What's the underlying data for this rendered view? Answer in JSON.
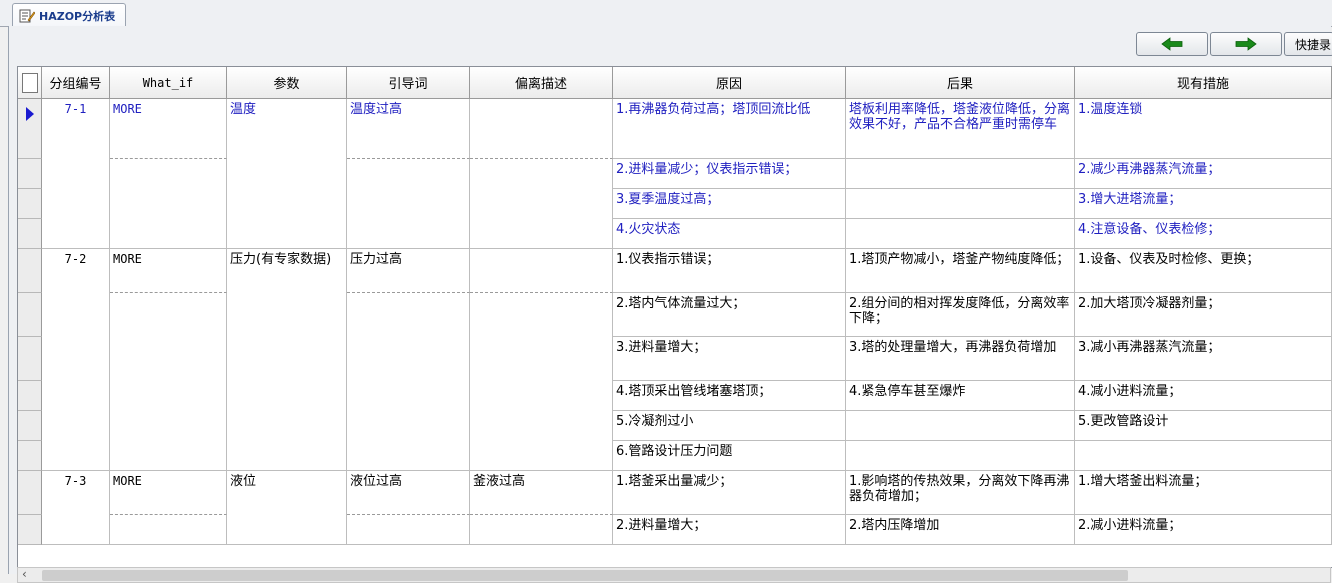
{
  "tab": {
    "title": "HAZOP分析表"
  },
  "toolbar": {
    "prev_icon": "arrow-left-icon",
    "next_icon": "arrow-right-icon",
    "shortcut_label": "快捷录",
    "arrow_color": "#1a8a1a"
  },
  "columns": [
    "分组编号",
    "What_if",
    "参数",
    "引导词",
    "偏离描述",
    "原因",
    "后果",
    "现有措施"
  ],
  "groups": [
    {
      "id": "7-1",
      "what_if": "MORE",
      "param": "温度",
      "guide": "温度过高",
      "deviation": ""
    },
    {
      "id": "7-2",
      "what_if": "MORE",
      "param": "压力(有专家数据)",
      "guide": "压力过高",
      "deviation": ""
    },
    {
      "id": "7-3",
      "what_if": "MORE",
      "param": "液位",
      "guide": "液位过高",
      "deviation": "釜液过高"
    }
  ],
  "rows": [
    {
      "cause": "1.再沸器负荷过高；塔顶回流比低",
      "consequence": "塔板利用率降低，塔釜液位降低，分离效果不好，产品不合格严重时需停车",
      "measure": "1.温度连锁"
    },
    {
      "cause": "2.进料量减少；仪表指示错误；",
      "consequence": "",
      "measure": "2.减少再沸器蒸汽流量；"
    },
    {
      "cause": "3.夏季温度过高；",
      "consequence": "",
      "measure": "3.增大进塔流量；"
    },
    {
      "cause": "4.火灾状态",
      "consequence": "",
      "measure": "4.注意设备、仪表检修；"
    },
    {
      "cause": "1.仪表指示错误；",
      "consequence": "1.塔顶产物减小，塔釜产物纯度降低；",
      "measure": "1.设备、仪表及时检修、更换；"
    },
    {
      "cause": "2.塔内气体流量过大；",
      "consequence": "2.组分间的相对挥发度降低，分离效率下降；",
      "measure": "2.加大塔顶冷凝器剂量；"
    },
    {
      "cause": "3.进料量增大；",
      "consequence": "3.塔的处理量增大，再沸器负荷增加",
      "measure": "3.减小再沸器蒸汽流量；"
    },
    {
      "cause": "4.塔顶采出管线堵塞塔顶；",
      "consequence": "4.紧急停车甚至爆炸",
      "measure": "4.减小进料流量；"
    },
    {
      "cause": "5.冷凝剂过小",
      "consequence": "",
      "measure": "5.更改管路设计"
    },
    {
      "cause": "6.管路设计压力问题",
      "consequence": "",
      "measure": ""
    },
    {
      "cause": "1.塔釜采出量减少；",
      "consequence": "1.影响塔的传热效果，分离效下降再沸器负荷增加；",
      "measure": "1.增大塔釜出料流量；"
    },
    {
      "cause": "2.进料量增大；",
      "consequence": "2.塔内压降增加",
      "measure": "2.减小进料流量；"
    }
  ],
  "scrollbar": {
    "left_arrow": "‹"
  }
}
